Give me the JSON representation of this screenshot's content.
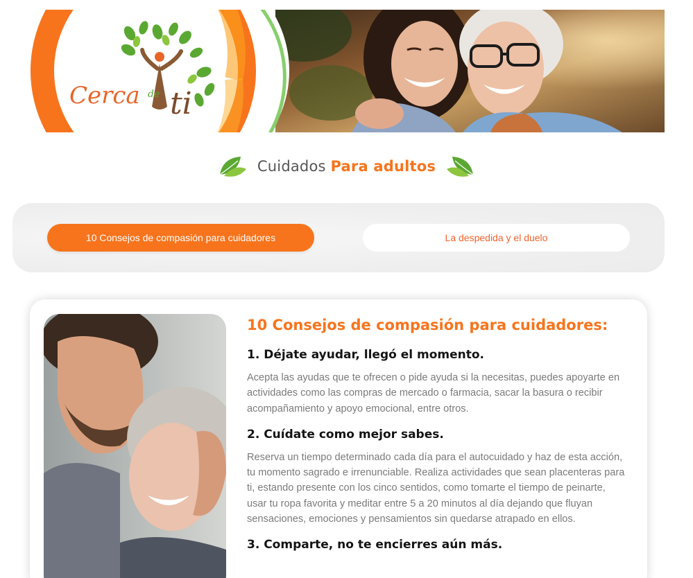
{
  "logo": {
    "word1": "Cerca",
    "word2": "de",
    "word3": "ti"
  },
  "banner": {
    "photo": "two-women-hugging-photo"
  },
  "section": {
    "title_plain": "Cuidados",
    "title_highlight": "Para adultos",
    "leaf_icon": "leaf-icon"
  },
  "tabs": [
    {
      "label": "10 Consejos de compasión para cuidadores",
      "active": true
    },
    {
      "label": "La despedida y el duelo",
      "active": false
    }
  ],
  "card": {
    "photo": "man-kissing-woman-forehead-photo",
    "heading": "10 Consejos de compasión para cuidadores:",
    "tips": [
      {
        "title": "1. Déjate ayudar, llegó el momento.",
        "body": "Acepta las ayudas que te ofrecen o pide ayuda si la necesitas, puedes apoyarte en actividades como las compras de mercado o farmacia, sacar la basura o recibir acompañamiento y apoyo emocional, entre otros."
      },
      {
        "title": "2. Cuídate como mejor sabes.",
        "body": "Reserva un tiempo determinado cada día para el autocuidado y haz de esta acción, tu momento sagrado e irrenunciable. Realiza actividades que sean placenteras para ti, estando presente con los cinco sentidos, como tomarte el tiempo de peinarte, usar tu ropa favorita y meditar entre 5 a 20 minutos al día dejando que fluyan sensaciones, emociones y pensamientos sin quedarse atrapado en ellos."
      },
      {
        "title": "3. Comparte, no te encierres aún más.",
        "body": ""
      }
    ]
  },
  "colors": {
    "accent": "#f7741d",
    "logo_brown": "#7a4a2a",
    "logo_orange": "#e8652a",
    "leaf_green": "#5aa832",
    "body_text": "#7a7a7a"
  }
}
